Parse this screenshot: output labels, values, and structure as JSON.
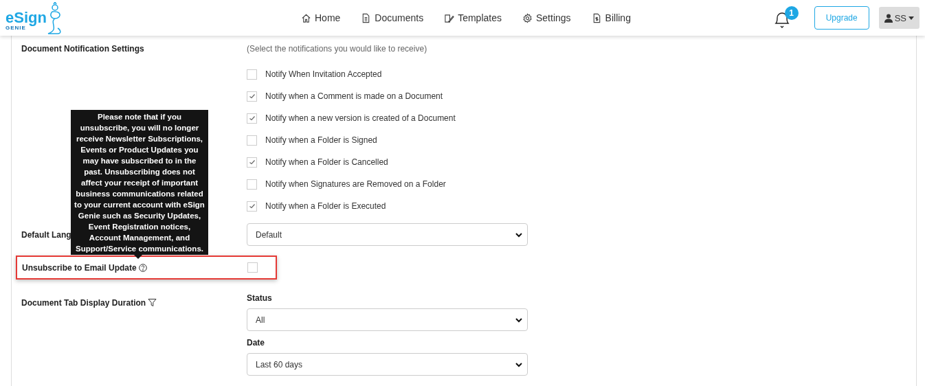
{
  "header": {
    "logo": {
      "word": "eSign",
      "sub": "GENIE"
    },
    "nav": [
      {
        "label": "Home"
      },
      {
        "label": "Documents"
      },
      {
        "label": "Templates"
      },
      {
        "label": "Settings"
      },
      {
        "label": "Billing"
      }
    ],
    "notifications": {
      "count": "1"
    },
    "upgrade_button": "Upgrade",
    "user_menu": "SS"
  },
  "notification_settings": {
    "label": "Document Notification Settings",
    "hint": "(Select the notifications you would like to receive)",
    "options": [
      {
        "label": "Notify When Invitation Accepted",
        "checked": false
      },
      {
        "label": "Notify when a Comment is made on a Document",
        "checked": true
      },
      {
        "label": "Notify when a new version is created of a Document",
        "checked": true
      },
      {
        "label": "Notify when a Folder is Signed",
        "checked": false
      },
      {
        "label": "Notify when a Folder is Cancelled",
        "checked": true
      },
      {
        "label": "Notify when Signatures are Removed on a Folder",
        "checked": false
      },
      {
        "label": "Notify when a Folder is Executed",
        "checked": true
      }
    ]
  },
  "default_language": {
    "label": "Default Lang",
    "value": "Default"
  },
  "unsubscribe": {
    "label": "Unsubscribe to Email Update",
    "checked": false,
    "highlighted": true,
    "tooltip": "Please note that if you unsubscribe, you will no longer receive Newsletter Subscriptions, Events or Product Updates you may have subscribed to in the past. Unsubscribing does not affect your receipt of important business communications related to your current account with eSign Genie such as Security Updates, Event Registration notices, Account Management, and Support/Service communications."
  },
  "document_tab_duration": {
    "label": "Document Tab Display Duration",
    "filters": [
      {
        "label": "Status",
        "value": "All"
      },
      {
        "label": "Date",
        "value": "Last 60 days"
      }
    ]
  }
}
